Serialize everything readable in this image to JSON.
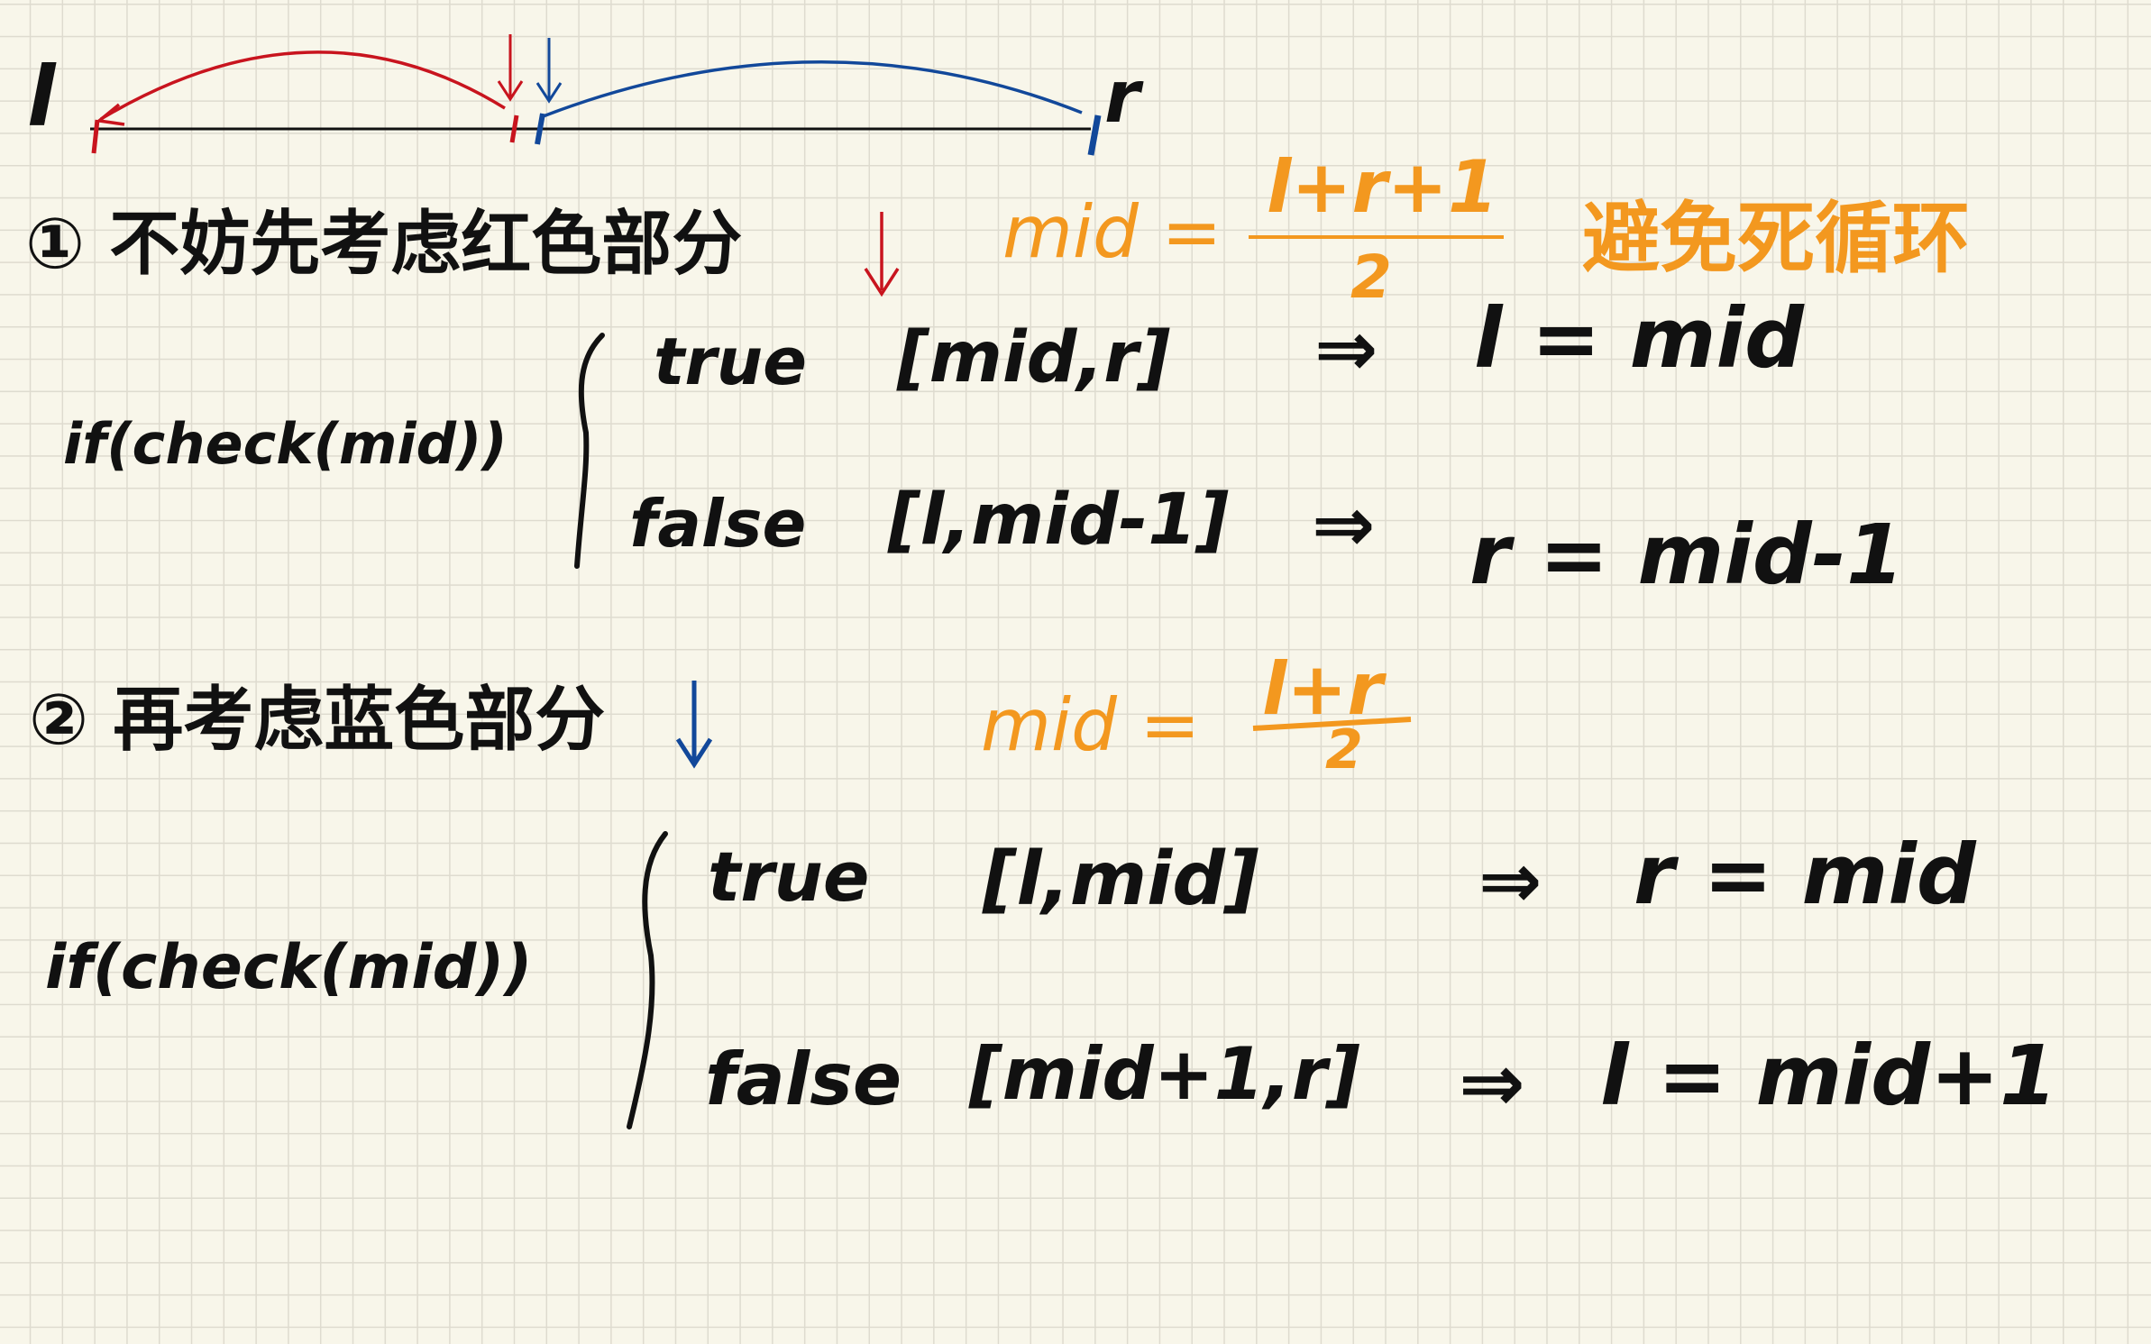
{
  "colors": {
    "ink": "#111111",
    "red": "#c8141e",
    "blue": "#12489a",
    "orange": "#f3981f",
    "paper": "#f8f6ea",
    "grid": "#dedbcf"
  },
  "diagram": {
    "left_label": "l",
    "right_label": "r",
    "left_part_color": "red",
    "right_part_color": "blue"
  },
  "part1": {
    "heading": "① 不妨先考虑红色部分",
    "arrow_icon": "down-arrow-red",
    "mid_label": "mid =",
    "mid_numerator": "l+r+1",
    "mid_denominator": "2",
    "note": "避免死循环",
    "condition": "if(check(mid))",
    "true_label": "true",
    "true_interval": "[mid,r]",
    "true_implies": "⇒",
    "true_result": "l = mid",
    "false_label": "false",
    "false_interval": "[l,mid-1]",
    "false_implies": "⇒",
    "false_result": "r = mid-1"
  },
  "part2": {
    "heading": "② 再考虑蓝色部分",
    "arrow_icon": "down-arrow-blue",
    "mid_label": "mid =",
    "mid_numerator": "l+r",
    "mid_denominator": "2",
    "condition": "if(check(mid))",
    "true_label": "true",
    "true_interval": "[l,mid]",
    "true_implies": "⇒",
    "true_result": "r = mid",
    "false_label": "false",
    "false_interval": "[mid+1,r]",
    "false_implies": "⇒",
    "false_result": "l = mid+1"
  }
}
